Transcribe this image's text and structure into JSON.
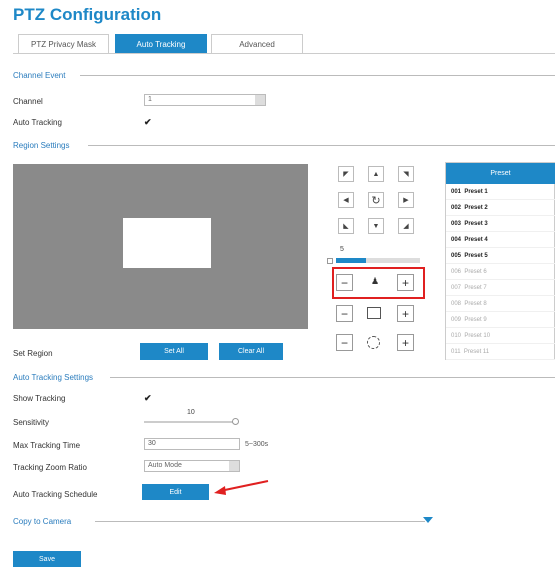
{
  "page_title": "PTZ Configuration",
  "tabs": [
    {
      "label": "PTZ Privacy Mask",
      "active": false
    },
    {
      "label": "Auto Tracking",
      "active": true
    },
    {
      "label": "Advanced",
      "active": false
    }
  ],
  "channel_event": {
    "section_title": "Channel Event",
    "channel_label": "Channel",
    "channel_value": "1",
    "auto_tracking_label": "Auto Tracking",
    "auto_tracking_checked": true
  },
  "region_settings": {
    "section_title": "Region Settings",
    "set_region_label": "Set Region",
    "set_all_label": "Set All",
    "clear_all_label": "Clear All"
  },
  "ptz": {
    "speed_value": "5",
    "zoom_minus": "−",
    "zoom_plus": "+",
    "focus_minus": "−",
    "focus_plus": "+",
    "iris_minus": "−",
    "iris_plus": "+"
  },
  "preset": {
    "header": "Preset",
    "items": [
      {
        "label": "001  Preset 1",
        "set": true
      },
      {
        "label": "002  Preset 2",
        "set": true
      },
      {
        "label": "003  Preset 3",
        "set": true
      },
      {
        "label": "004  Preset 4",
        "set": true
      },
      {
        "label": "005  Preset 5",
        "set": true
      },
      {
        "label": "006  Preset 6",
        "set": false
      },
      {
        "label": "007  Preset 7",
        "set": false
      },
      {
        "label": "008  Preset 8",
        "set": false
      },
      {
        "label": "009  Preset 9",
        "set": false
      },
      {
        "label": "010  Preset 10",
        "set": false
      },
      {
        "label": "011  Preset 11",
        "set": false
      }
    ]
  },
  "auto_tracking_settings": {
    "section_title": "Auto Tracking Settings",
    "show_tracking_label": "Show Tracking",
    "show_tracking_checked": true,
    "sensitivity_label": "Sensitivity",
    "sensitivity_value": "10",
    "max_tracking_time_label": "Max Tracking Time",
    "max_tracking_time_value": "30",
    "max_tracking_time_range": "5~300s",
    "tracking_zoom_ratio_label": "Tracking Zoom Ratio",
    "tracking_zoom_ratio_value": "Auto Mode",
    "schedule_label": "Auto Tracking Schedule",
    "schedule_button": "Edit"
  },
  "copy_to_camera": {
    "label": "Copy to Camera"
  },
  "save_button": "Save",
  "colors": {
    "accent": "#1e88c7",
    "highlight_box": "#e02020",
    "arrow": "#e02020"
  }
}
